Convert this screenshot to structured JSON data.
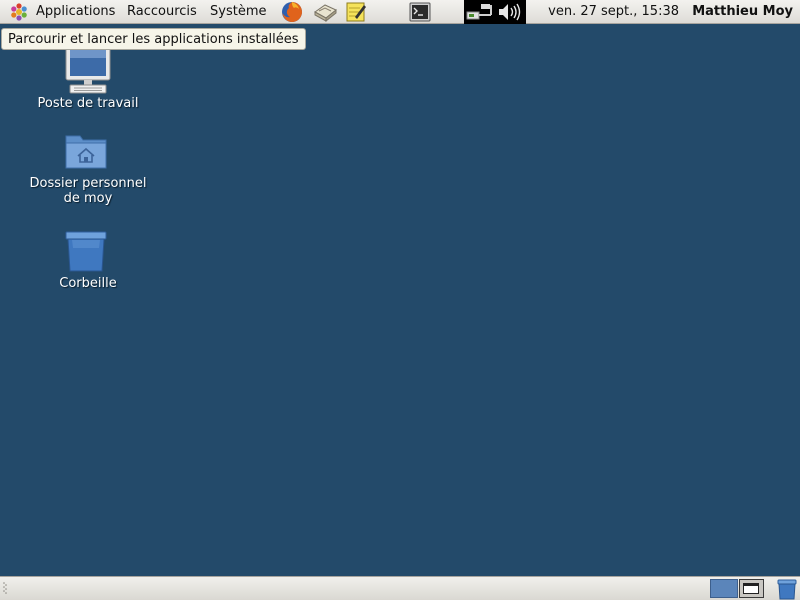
{
  "top_panel": {
    "menus": {
      "applications": "Applications",
      "raccourcis": "Raccourcis",
      "systeme": "Système"
    },
    "launchers": [
      "firefox-icon",
      "mail-icon",
      "notes-icon",
      "terminal-icon"
    ],
    "tray": [
      "network-icon",
      "volume-icon"
    ],
    "clock": "ven. 27 sept., 15:38",
    "user": "Matthieu Moy"
  },
  "tooltip": {
    "text": "Parcourir et lancer les applications installées"
  },
  "desktop": {
    "background_color": "#234a6a",
    "icons": [
      {
        "label": "Poste de travail",
        "icon": "computer-icon"
      },
      {
        "label": "Dossier personnel",
        "label2": "de moy",
        "icon": "home-folder-icon"
      },
      {
        "label": "Corbeille",
        "icon": "trash-icon"
      }
    ]
  },
  "bottom_panel": {
    "workspaces": 2,
    "active_workspace": 1
  }
}
